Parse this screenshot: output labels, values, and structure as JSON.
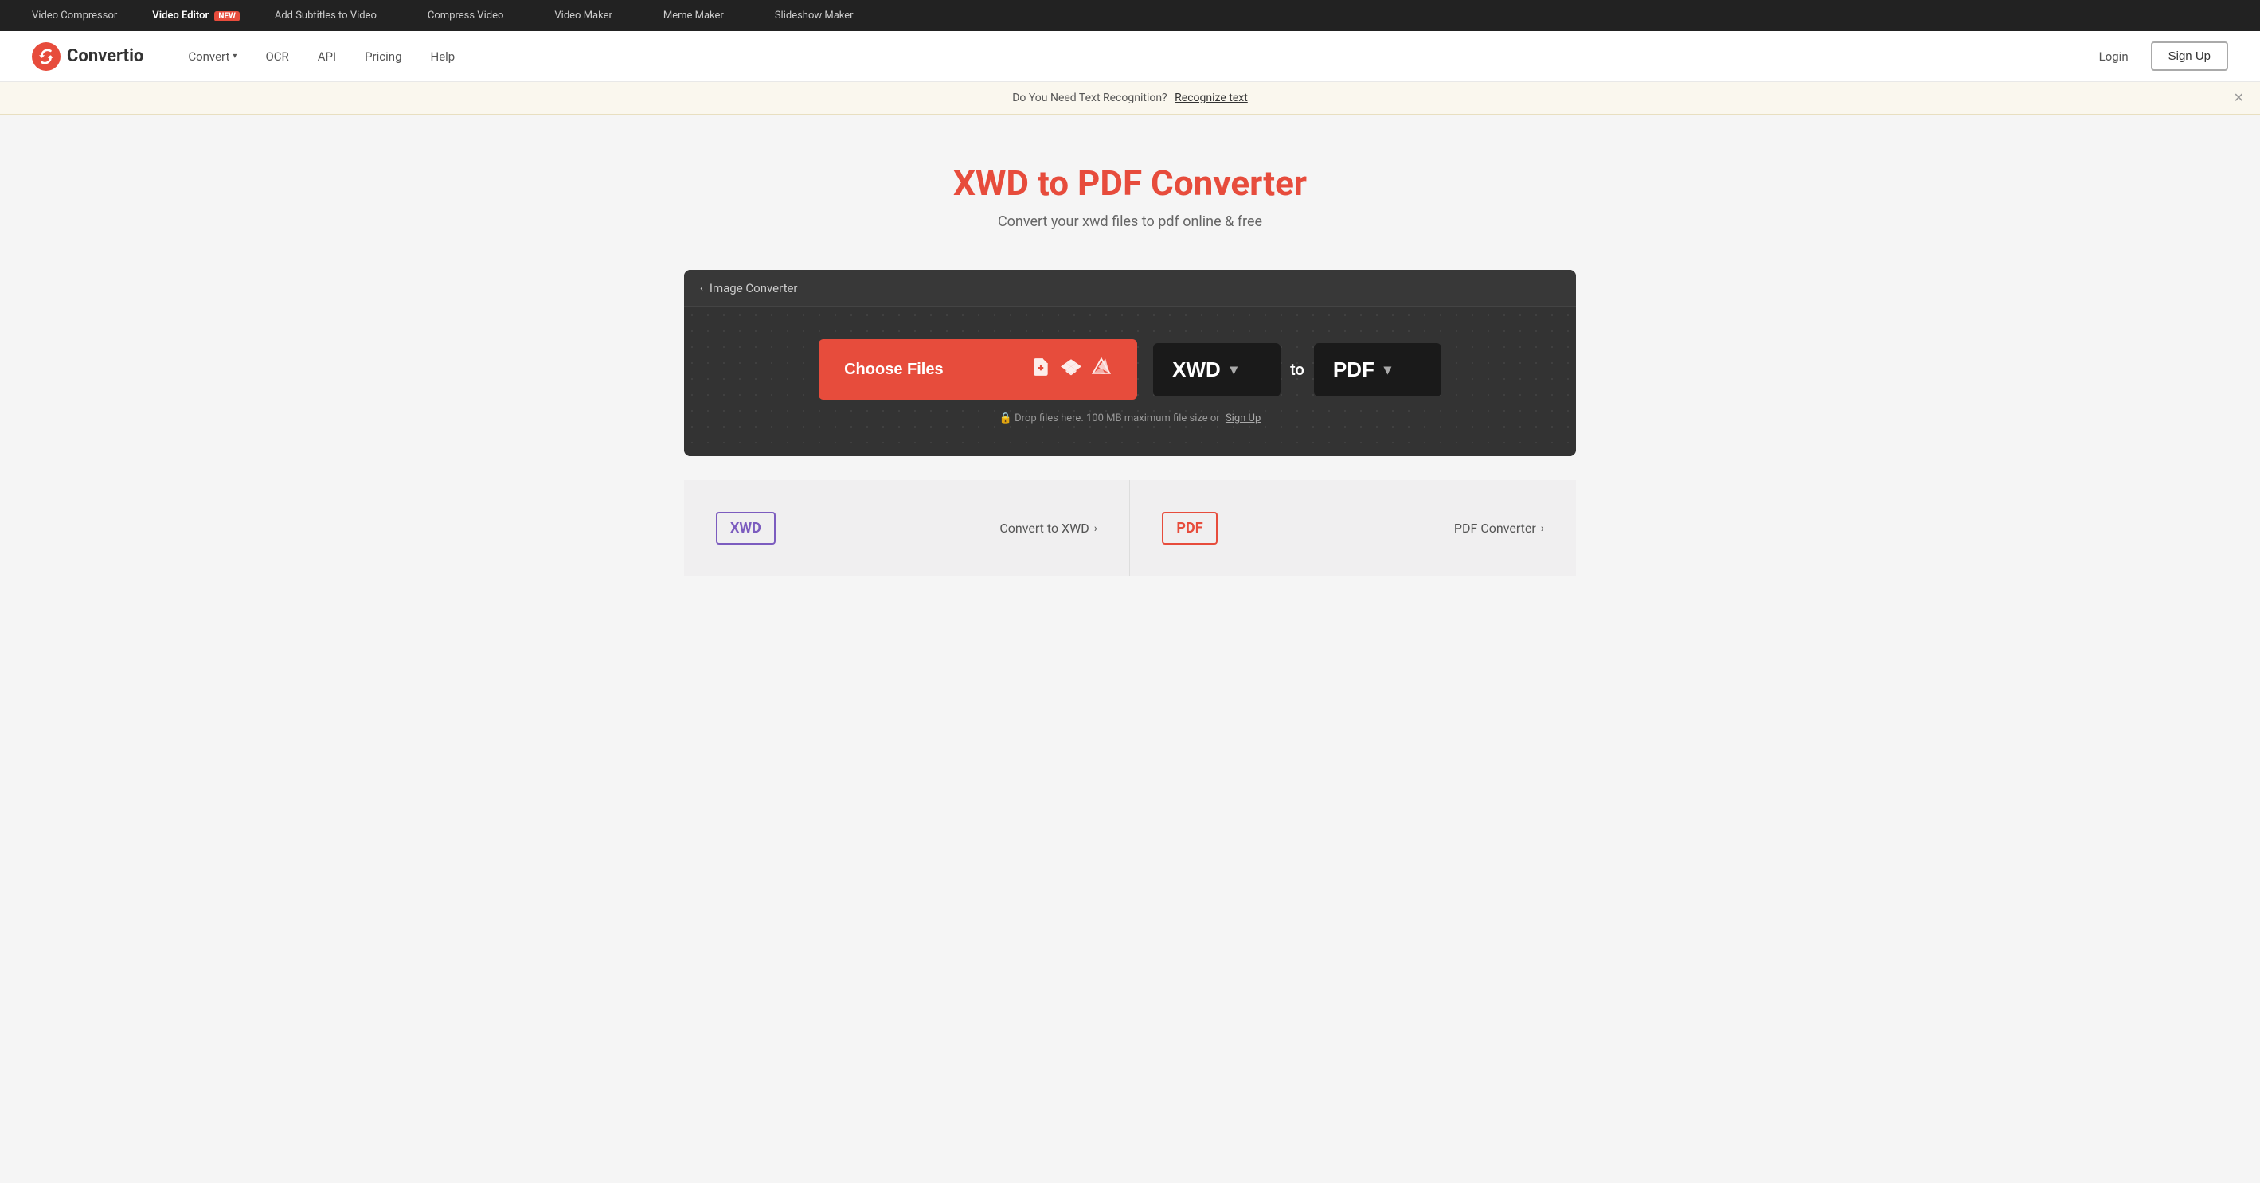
{
  "topbar": {
    "links": [
      {
        "id": "video-compressor",
        "label": "Video Compressor",
        "active": false
      },
      {
        "id": "video-editor",
        "label": "Video Editor",
        "active": true,
        "badge": "NEW"
      },
      {
        "id": "add-subtitles",
        "label": "Add Subtitles to Video",
        "active": false
      },
      {
        "id": "compress-video",
        "label": "Compress Video",
        "active": false
      },
      {
        "id": "video-maker",
        "label": "Video Maker",
        "active": false
      },
      {
        "id": "meme-maker",
        "label": "Meme Maker",
        "active": false
      },
      {
        "id": "slideshow-maker",
        "label": "Slideshow Maker",
        "active": false
      }
    ]
  },
  "nav": {
    "logo_text": "Convertio",
    "links": [
      {
        "id": "convert",
        "label": "Convert",
        "has_chevron": true
      },
      {
        "id": "ocr",
        "label": "OCR",
        "has_chevron": false
      },
      {
        "id": "api",
        "label": "API",
        "has_chevron": false
      },
      {
        "id": "pricing",
        "label": "Pricing",
        "has_chevron": false
      },
      {
        "id": "help",
        "label": "Help",
        "has_chevron": false
      }
    ],
    "login_label": "Login",
    "signup_label": "Sign Up"
  },
  "banner": {
    "text": "Do You Need Text Recognition?",
    "link_text": "Recognize text"
  },
  "hero": {
    "title": "XWD to PDF Converter",
    "subtitle": "Convert your xwd files to pdf online & free"
  },
  "converter": {
    "header": "Image Converter",
    "choose_files_label": "Choose Files",
    "from_format": "XWD",
    "to_label": "to",
    "to_format": "PDF",
    "drop_hint": "Drop files here. 100 MB maximum file size or",
    "drop_hint_link": "Sign Up"
  },
  "cards": [
    {
      "badge": "XWD",
      "badge_type": "xwd",
      "link_label": "Convert to XWD",
      "link_arrow": "›"
    },
    {
      "badge": "PDF",
      "badge_type": "pdf",
      "link_label": "PDF Converter",
      "link_arrow": "›"
    }
  ]
}
